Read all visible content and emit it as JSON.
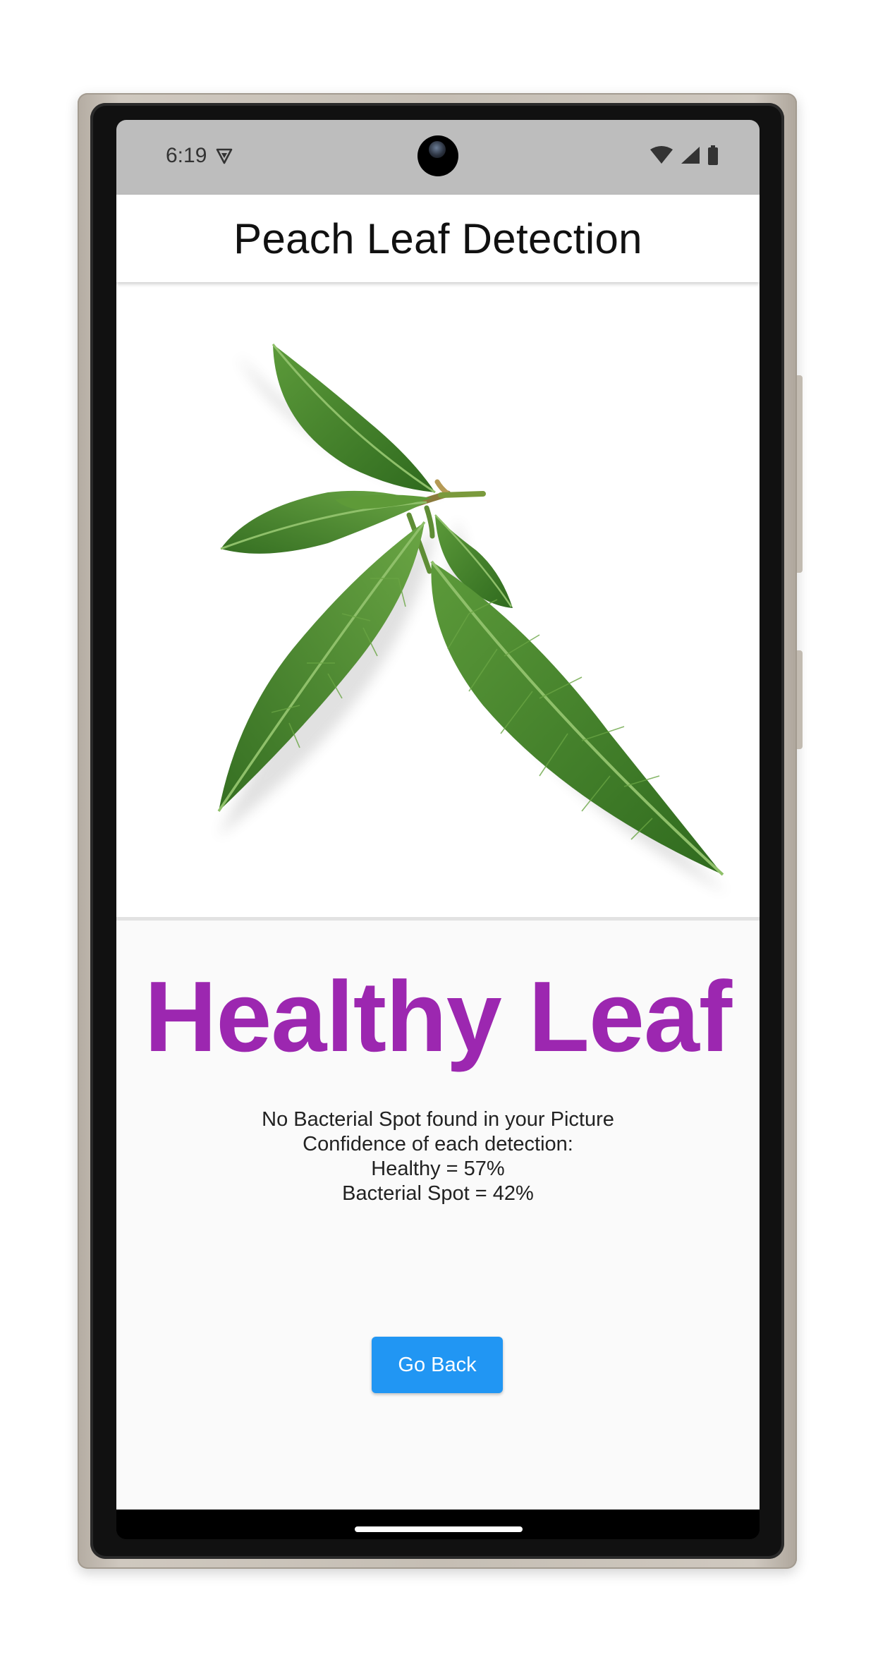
{
  "status_bar": {
    "time": "6:19",
    "left_icon": "vpn-shield-icon",
    "right_icons": [
      "wifi-icon",
      "cellular-signal-icon",
      "battery-icon"
    ]
  },
  "app_bar": {
    "title": "Peach Leaf Detection"
  },
  "photo": {
    "subject": "peach-leaf-image"
  },
  "result": {
    "title": "Healthy Leaf",
    "title_color": "#9c27b0",
    "message": "No Bacterial Spot found in your Picture",
    "confidence_heading": "Confidence of each detection:",
    "confidence_healthy": "Healthy = 57%",
    "confidence_bacterial": "Bacterial Spot = 42%"
  },
  "actions": {
    "go_back_label": "Go Back",
    "go_back_color": "#2196f3"
  }
}
